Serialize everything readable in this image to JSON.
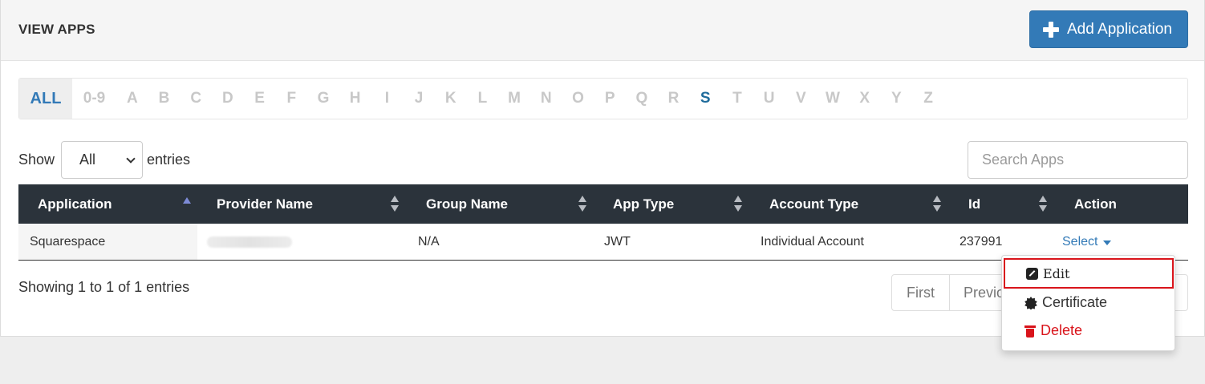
{
  "header": {
    "title": "VIEW APPS",
    "add_button_label": "Add Application"
  },
  "alphabet": {
    "items": [
      "ALL",
      "0-9",
      "A",
      "B",
      "C",
      "D",
      "E",
      "F",
      "G",
      "H",
      "I",
      "J",
      "K",
      "L",
      "M",
      "N",
      "O",
      "P",
      "Q",
      "R",
      "S",
      "T",
      "U",
      "V",
      "W",
      "X",
      "Y",
      "Z"
    ],
    "selected": "ALL",
    "active": "S"
  },
  "length_control": {
    "show_label": "Show",
    "selected": "All",
    "entries_label": "entries"
  },
  "search": {
    "placeholder": "Search Apps"
  },
  "table": {
    "columns": [
      "Application",
      "Provider Name",
      "Group Name",
      "App Type",
      "Account Type",
      "Id",
      "Action"
    ],
    "rows": [
      {
        "application": "Squarespace",
        "provider": "",
        "group": "N/A",
        "app_type": "JWT",
        "account_type": "Individual Account",
        "id": "237991",
        "action": "Select"
      }
    ]
  },
  "footer": {
    "info": "Showing 1 to 1 of 1 entries",
    "pager_first": "First",
    "pager_prev": "Previous"
  },
  "dropdown": {
    "edit": "Edit",
    "certificate": "Certificate",
    "delete": "Delete"
  },
  "colors": {
    "primary": "#337ab7",
    "header_dark": "#2b333b",
    "danger": "#d9141b",
    "active_letter": "#1f6c9c"
  }
}
